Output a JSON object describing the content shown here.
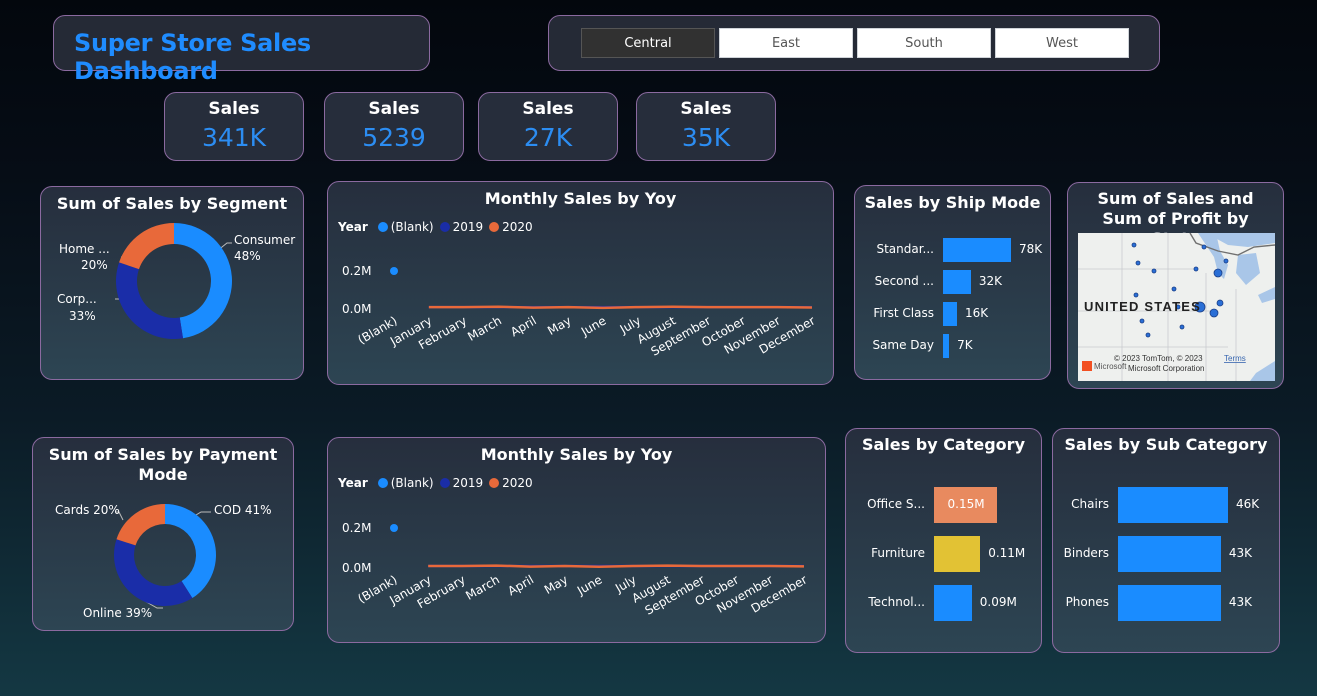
{
  "header": {
    "title": "Super Store Sales Dashboard"
  },
  "region_slicer": {
    "options": [
      "Central",
      "East",
      "South",
      "West"
    ],
    "selected": "Central"
  },
  "kpis": [
    {
      "label": "Sales",
      "value": "341K"
    },
    {
      "label": "Sales",
      "value": "5239"
    },
    {
      "label": "Sales",
      "value": "27K"
    },
    {
      "label": "Sales",
      "value": "35K"
    }
  ],
  "segment_chart": {
    "title": "Sum of Sales by Segment",
    "slices": [
      {
        "name": "Consumer",
        "pct_label": "48%",
        "value": 48,
        "color": "#1a8cff"
      },
      {
        "name": "Corp...",
        "pct_label": "33%",
        "value": 33,
        "color": "#1a2da8"
      },
      {
        "name": "Home ...",
        "pct_label": "20%",
        "value": 20,
        "color": "#e8693a"
      }
    ]
  },
  "monthly_1": {
    "title": "Monthly Sales by Yoy",
    "legend_title": "Year",
    "legend": [
      {
        "name": "(Blank)",
        "color": "#1a8cff"
      },
      {
        "name": "2019",
        "color": "#1a2da8"
      },
      {
        "name": "2020",
        "color": "#e8693a"
      }
    ],
    "y_ticks": [
      "0.2M",
      "0.0M"
    ],
    "x_labels": [
      "(Blank)",
      "January",
      "February",
      "March",
      "April",
      "May",
      "June",
      "July",
      "August",
      "September",
      "October",
      "November",
      "December"
    ]
  },
  "monthly_2": {
    "title": "Monthly Sales by Yoy",
    "legend_title": "Year",
    "legend": [
      {
        "name": "(Blank)",
        "color": "#1a8cff"
      },
      {
        "name": "2019",
        "color": "#1a2da8"
      },
      {
        "name": "2020",
        "color": "#e8693a"
      }
    ],
    "y_ticks": [
      "0.2M",
      "0.0M"
    ],
    "x_labels": [
      "(Blank)",
      "January",
      "February",
      "March",
      "April",
      "May",
      "June",
      "July",
      "August",
      "September",
      "October",
      "November",
      "December"
    ]
  },
  "ship_mode": {
    "title": "Sales by Ship Mode",
    "rows": [
      {
        "label": "Standar...",
        "value_label": "78K",
        "value": 78
      },
      {
        "label": "Second ...",
        "value_label": "32K",
        "value": 32
      },
      {
        "label": "First Class",
        "value_label": "16K",
        "value": 16
      },
      {
        "label": "Same Day",
        "value_label": "7K",
        "value": 7
      }
    ]
  },
  "map": {
    "title": "Sum of Sales and Sum of Profit by State",
    "country_label": "UNITED STATES",
    "attribution": "© 2023 TomTom, © 2023 Microsoft Corporation",
    "terms": "Terms",
    "brand": "Microsoft"
  },
  "payment_chart": {
    "title": "Sum of Sales by Payment Mode",
    "slices": [
      {
        "name": "COD",
        "label": "COD 41%",
        "value": 41,
        "color": "#1a8cff"
      },
      {
        "name": "Online",
        "label": "Online 39%",
        "value": 39,
        "color": "#1a2da8"
      },
      {
        "name": "Cards",
        "label": "Cards 20%",
        "value": 20,
        "color": "#e8693a"
      }
    ]
  },
  "category": {
    "title": "Sales by Category",
    "rows": [
      {
        "label": "Office S...",
        "value_label": "0.15M",
        "value": 0.15,
        "color": "#e88a5f"
      },
      {
        "label": "Furniture",
        "value_label": "0.11M",
        "value": 0.11,
        "color": "#e2c234"
      },
      {
        "label": "Technol...",
        "value_label": "0.09M",
        "value": 0.09,
        "color": "#1a8cff"
      }
    ]
  },
  "sub_category": {
    "title": "Sales by Sub Category",
    "rows": [
      {
        "label": "Chairs",
        "value_label": "46K",
        "value": 46
      },
      {
        "label": "Binders",
        "value_label": "43K",
        "value": 43
      },
      {
        "label": "Phones",
        "value_label": "43K",
        "value": 43
      }
    ]
  },
  "chart_data": [
    {
      "type": "pie",
      "title": "Sum of Sales by Segment",
      "categories": [
        "Consumer",
        "Corp...",
        "Home ..."
      ],
      "values": [
        48,
        33,
        20
      ]
    },
    {
      "type": "line",
      "title": "Monthly Sales by Yoy",
      "categories": [
        "(Blank)",
        "January",
        "February",
        "March",
        "April",
        "May",
        "June",
        "July",
        "August",
        "September",
        "October",
        "November",
        "December"
      ],
      "series": [
        {
          "name": "(Blank)",
          "values": [
            0.2,
            null,
            null,
            null,
            null,
            null,
            null,
            null,
            null,
            null,
            null,
            null,
            null
          ]
        },
        {
          "name": "2019",
          "values": [
            null,
            0.01,
            0.01,
            0.01,
            0.01,
            0.01,
            0.01,
            0.01,
            0.01,
            0.01,
            0.01,
            0.01,
            0.01
          ]
        },
        {
          "name": "2020",
          "values": [
            null,
            0.01,
            0.01,
            0.012,
            0.007,
            0.01,
            0.006,
            0.01,
            0.012,
            0.01,
            0.01,
            0.01,
            0.008
          ]
        }
      ],
      "ylim": [
        0,
        0.25
      ]
    },
    {
      "type": "bar",
      "title": "Sales by Ship Mode",
      "categories": [
        "Standar...",
        "Second ...",
        "First Class",
        "Same Day"
      ],
      "values": [
        78,
        32,
        16,
        7
      ]
    },
    {
      "type": "pie",
      "title": "Sum of Sales by Payment Mode",
      "categories": [
        "COD",
        "Online",
        "Cards"
      ],
      "values": [
        41,
        39,
        20
      ]
    },
    {
      "type": "line",
      "title": "Monthly Sales by Yoy",
      "categories": [
        "(Blank)",
        "January",
        "February",
        "March",
        "April",
        "May",
        "June",
        "July",
        "August",
        "September",
        "October",
        "November",
        "December"
      ],
      "series": [
        {
          "name": "(Blank)",
          "values": [
            0.2,
            null,
            null,
            null,
            null,
            null,
            null,
            null,
            null,
            null,
            null,
            null,
            null
          ]
        },
        {
          "name": "2019",
          "values": [
            null,
            0.01,
            0.01,
            0.01,
            0.01,
            0.01,
            0.01,
            0.01,
            0.01,
            0.01,
            0.01,
            0.01,
            0.01
          ]
        },
        {
          "name": "2020",
          "values": [
            null,
            0.01,
            0.01,
            0.012,
            0.007,
            0.01,
            0.006,
            0.01,
            0.012,
            0.01,
            0.01,
            0.01,
            0.008
          ]
        }
      ],
      "ylim": [
        0,
        0.25
      ]
    },
    {
      "type": "bar",
      "title": "Sales by Category",
      "categories": [
        "Office S...",
        "Furniture",
        "Technol..."
      ],
      "values": [
        0.15,
        0.11,
        0.09
      ]
    },
    {
      "type": "bar",
      "title": "Sales by Sub Category",
      "categories": [
        "Chairs",
        "Binders",
        "Phones"
      ],
      "values": [
        46,
        43,
        43
      ]
    }
  ]
}
